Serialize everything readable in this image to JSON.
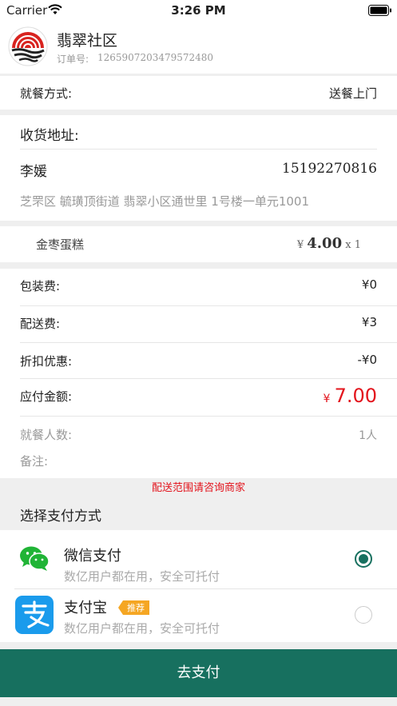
{
  "status_bar": {
    "carrier": "Carrier",
    "time": "3:26 PM"
  },
  "header": {
    "shop_name": "翡翠社区",
    "order_label": "订单号:",
    "order_no": "1265907203479572480"
  },
  "dining": {
    "label": "就餐方式:",
    "value": "送餐上门"
  },
  "address": {
    "title": "收货地址:",
    "name": "李媛",
    "phone": "15192270816",
    "detail": "芝罘区 毓璜顶街道 翡翠小区通世里 1号楼一单元1001"
  },
  "item": {
    "name": "金枣蛋糕",
    "currency": "¥",
    "price": "4.00",
    "qty": "x 1"
  },
  "fees": {
    "packing_label": "包装费:",
    "packing_value": "¥0",
    "delivery_label": "配送费:",
    "delivery_value": "¥3",
    "discount_label": "折扣优惠:",
    "discount_value": "-¥0",
    "total_label": "应付金额:",
    "total_currency": "¥",
    "total_value": "7.00",
    "people_label": "就餐人数:",
    "people_value": "1人",
    "remark_label": "备注:"
  },
  "notice": "配送范围请咨询商家",
  "payment": {
    "title": "选择支付方式",
    "wechat": {
      "name": "微信支付",
      "desc": "数亿用户都在用，安全可托付",
      "selected": true
    },
    "alipay": {
      "name": "支付宝",
      "badge": "推荐",
      "desc": "数亿用户都在用，安全可托付",
      "selected": false
    }
  },
  "pay_button": "去支付",
  "colors": {
    "accent": "#17705f",
    "price_red": "#e3141d",
    "badge": "#f5a623",
    "wechat": "#20b436",
    "alipay": "#1a9bec"
  }
}
